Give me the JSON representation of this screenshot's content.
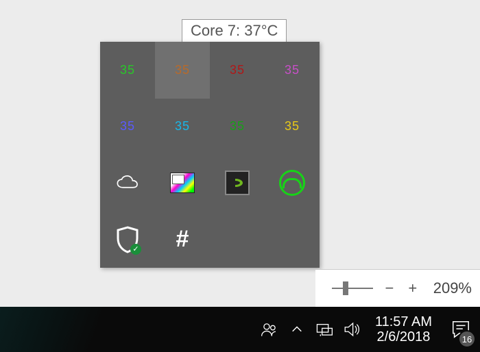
{
  "tooltip": {
    "text": "Core 7: 37°C"
  },
  "tray": {
    "cores": [
      {
        "value": "35",
        "color": "#29c729"
      },
      {
        "value": "35",
        "color": "#b86a2a",
        "hovered": true
      },
      {
        "value": "35",
        "color": "#b01818"
      },
      {
        "value": "35",
        "color": "#c84fc8"
      },
      {
        "value": "35",
        "color": "#5a5aff"
      },
      {
        "value": "35",
        "color": "#17b7e8"
      },
      {
        "value": "35",
        "color": "#17a017"
      },
      {
        "value": "35",
        "color": "#e8c917"
      }
    ]
  },
  "zoom": {
    "minus": "−",
    "plus": "+",
    "value": "209%"
  },
  "clock": {
    "time": "11:57 AM",
    "date": "2/6/2018"
  },
  "action_center": {
    "badge": "16"
  }
}
